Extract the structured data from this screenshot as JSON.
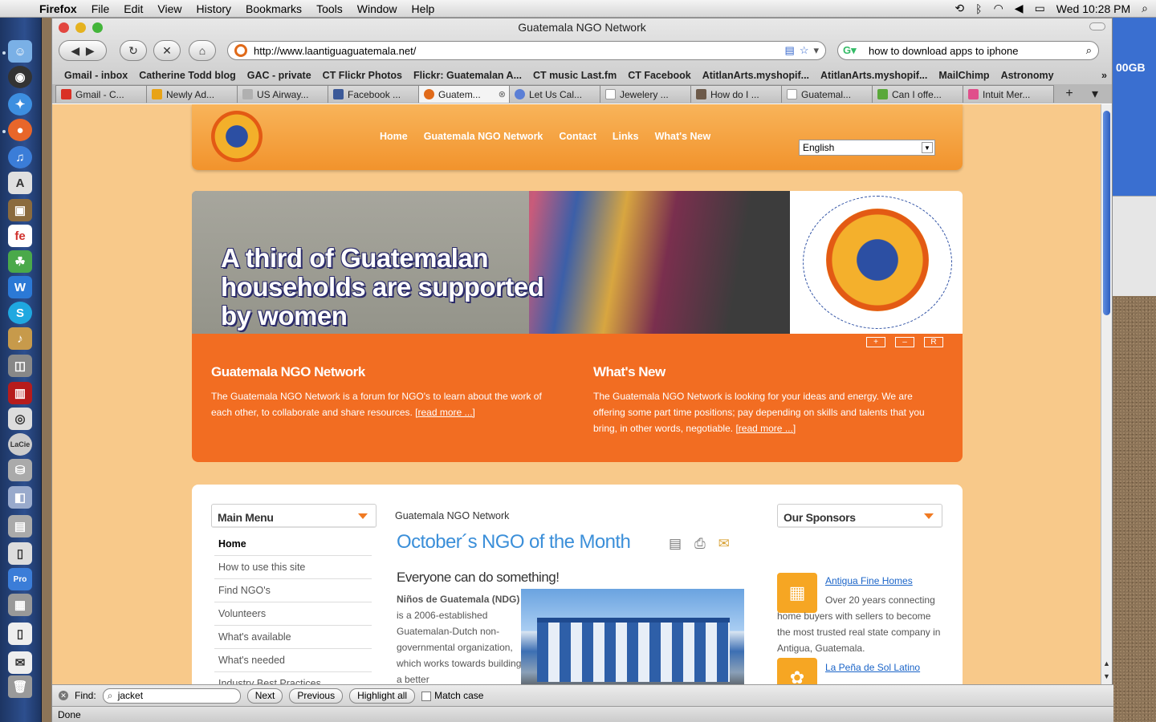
{
  "menubar": {
    "app": "Firefox",
    "items": [
      "File",
      "Edit",
      "View",
      "History",
      "Bookmarks",
      "Tools",
      "Window",
      "Help"
    ],
    "clock": "Wed 10:28 PM"
  },
  "window": {
    "title": "Guatemala NGO Network"
  },
  "toolbar": {
    "url": "http://www.laantiguaguatemala.net/",
    "search_value": "how to download apps to iphone"
  },
  "bookmarks": [
    "Gmail - inbox",
    "Catherine Todd blog",
    "GAC - private",
    "CT Flickr Photos",
    "Flickr: Guatemalan A...",
    "CT music Last.fm",
    "CT Facebook",
    "AtitlanArts.myshopif...",
    "AtitlanArts.myshopif...",
    "MailChimp",
    "Astronomy"
  ],
  "tabs": [
    {
      "label": "Gmail - C...",
      "color": "#d93025"
    },
    {
      "label": "Newly Ad...",
      "color": "#e8a317"
    },
    {
      "label": "US Airway...",
      "color": "#b0b0b0"
    },
    {
      "label": "Facebook ...",
      "color": "#3b5998"
    },
    {
      "label": "Guatem...",
      "color": "#e06a1a",
      "active": true
    },
    {
      "label": "Let Us Cal...",
      "color": "#5b7fd6"
    },
    {
      "label": "Jewelery ...",
      "color": "#ffffff"
    },
    {
      "label": "How do I ...",
      "color": "#6d5a4a"
    },
    {
      "label": "Guatemal...",
      "color": "#ffffff"
    },
    {
      "label": "Can I offe...",
      "color": "#5aa83a"
    },
    {
      "label": "Intuit Mer...",
      "color": "#e04f8b"
    }
  ],
  "site": {
    "nav": [
      "Home",
      "Guatemala NGO Network",
      "Contact",
      "Links",
      "What's New"
    ],
    "language": "English",
    "banner_caption_lines": [
      "A third of Guatemalan",
      "households are supported",
      "by women"
    ],
    "slide_controls": [
      "+",
      "–",
      "R"
    ],
    "intro": [
      {
        "title": "Guatemala NGO Network",
        "text": "The Guatemala NGO Network is a forum for NGO's to learn about the work of each other, to collaborate and share resources.",
        "link": "[read more ...]"
      },
      {
        "title": "What's New",
        "text": "The Guatemala NGO Network is looking for your ideas and energy. We are offering some part time positions; pay depending on skills and talents that you bring, in other words, negotiable.",
        "link": "[read more ...]"
      }
    ],
    "main_menu_title": "Main Menu",
    "main_menu": [
      "Home",
      "How to use this site",
      "Find NGO's",
      "Volunteers",
      "What's available",
      "What's needed",
      "Industry Best Practices"
    ],
    "breadcrumb": "Guatemala NGO Network",
    "article_title": "October´s NGO of the Month",
    "article_subtitle": "Everyone can do something!",
    "article_bold": "Niños de Guatemala (NDG)",
    "article_text": " is a 2006-established Guatemalan-Dutch non-governmental organization, which works towards building a better",
    "sponsors_title": "Our Sponsors",
    "sponsors": [
      {
        "name": "Antigua Fine Homes",
        "text": "Over 20 years connecting home buyers with sellers to become the most trusted real state company in Antigua, Guatemala."
      },
      {
        "name": "La Peña de Sol Latino",
        "text": ""
      }
    ]
  },
  "findbar": {
    "label": "Find:",
    "value": "jacket",
    "next": "Next",
    "previous": "Previous",
    "highlight": "Highlight all",
    "match_case": "Match case"
  },
  "status": "Done",
  "desktop": {
    "disk_label": "00GB"
  }
}
